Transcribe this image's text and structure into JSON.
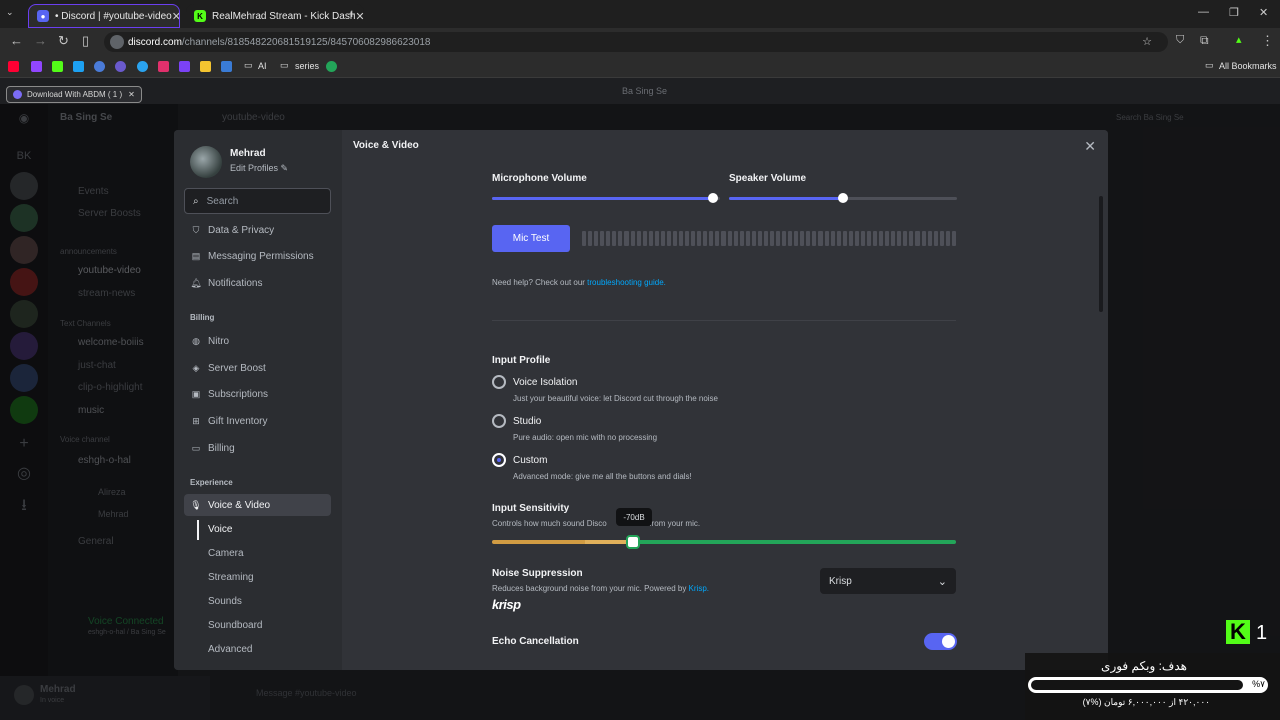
{
  "browser": {
    "tabs": [
      {
        "label": "• Discord | #youtube-video"
      },
      {
        "label": "RealMehrad Stream - Kick Dash"
      }
    ],
    "url_host": "discord.com",
    "url_path": "/channels/818548220681519125/845706082986623018",
    "bookmarks": {
      "folder1": "AI",
      "folder2": "series",
      "all": "All Bookmarks"
    },
    "download_pill": "Download With ABDM ( 1 )"
  },
  "discord": {
    "server_name": "Ba Sing Se",
    "channel_name": "youtube-video",
    "channels": [
      "Events",
      "Server Boosts",
      "announcements",
      "youtube-video",
      "stream-news",
      "Text Channels",
      "welcome-boiiis",
      "just-chat",
      "clip-o-highlight",
      "music",
      "Voice channel",
      "eshgh-o-hal",
      "Alireza",
      "Mehrad",
      "General"
    ],
    "voice_connected": "Voice Connected",
    "voice_sub": "eshgh-o-hal / Ba Sing Se",
    "user": {
      "name": "Mehrad",
      "status": "In voice"
    },
    "message_placeholder": "Message #youtube-video",
    "search_server": "Search Ba Sing Se"
  },
  "settings": {
    "profile_name": "Mehrad",
    "edit_profiles": "Edit Profiles",
    "search_placeholder": "Search",
    "items_top": [
      "Data & Privacy",
      "Messaging Permissions",
      "Notifications"
    ],
    "billing_header": "Billing",
    "billing_items": [
      "Nitro",
      "Server Boost",
      "Subscriptions",
      "Gift Inventory",
      "Billing"
    ],
    "experience_header": "Experience",
    "active_item": "Voice & Video",
    "sub_items": [
      "Voice",
      "Camera",
      "Streaming",
      "Sounds",
      "Soundboard",
      "Advanced"
    ]
  },
  "voice": {
    "header": "Voice & Video",
    "mic_volume_label": "Microphone Volume",
    "speaker_volume_label": "Speaker Volume",
    "mic_volume": 0.97,
    "speaker_volume": 0.5,
    "mic_test": "Mic Test",
    "help_text": "Need help? Check out our ",
    "help_link": "troubleshooting guide.",
    "input_profile_label": "Input Profile",
    "profiles": [
      {
        "name": "Voice Isolation",
        "desc": "Just your beautiful voice: let Discord cut through the noise",
        "selected": false
      },
      {
        "name": "Studio",
        "desc": "Pure audio: open mic with no processing",
        "selected": false
      },
      {
        "name": "Custom",
        "desc": "Advanced mode: give me all the buttons and dials!",
        "selected": true
      }
    ],
    "sensitivity_label": "Input Sensitivity",
    "sensitivity_desc_a": "Controls how much sound Disco",
    "sensitivity_desc_b": "nits from your mic.",
    "sensitivity_tooltip": "-70dB",
    "noise_label": "Noise Suppression",
    "noise_desc": "Reduces background noise from your mic. Powered by ",
    "noise_link": "Krisp.",
    "noise_value": "Krisp",
    "krisp_logo": "krisp",
    "echo_label": "Echo Cancellation",
    "echo_on": true
  },
  "overlay": {
    "goal_title": "هدف: وبکم فوری",
    "percent": "%۷",
    "amount": "۴۲۰,۰۰۰ از ۶,۰۰۰,۰۰۰ تومان (%۷)",
    "progress": 0.07,
    "kick_count": "1"
  },
  "colors": {
    "accent": "#5865f2",
    "green": "#23a559",
    "kick": "#53fc18"
  }
}
